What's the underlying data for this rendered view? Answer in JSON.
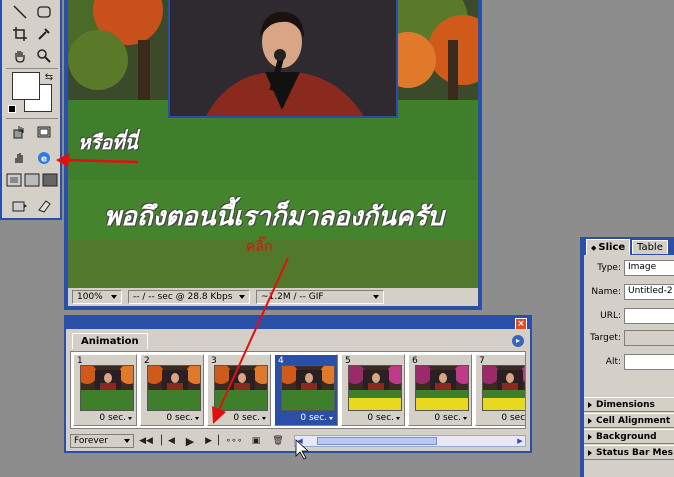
{
  "toolbox": {
    "tools": [
      "line-tool",
      "rounded-rect-tool",
      "crop-tool",
      "eyedropper-tool",
      "hand-tool",
      "zoom-tool",
      "rollover-tool",
      "slice-select-tool",
      "hand-select-tool",
      "jump-to-browser-tool",
      "standard-mode",
      "full-screen-menu-mode",
      "full-screen-mode",
      "jump-to-photoshop-tool",
      "eraser-tool"
    ]
  },
  "overlay": {
    "or_here": "หรือที่นี่",
    "main_caption": "พอถึงตอนนี้เราก็มาลองกันครับ",
    "click": "คลิ๊ก"
  },
  "statusbar": {
    "zoom": "100%",
    "timing": "-- / -- sec @ 28.8 Kbps",
    "size": "~1.2M / -- GIF"
  },
  "animation": {
    "title": "Animation",
    "frames": [
      {
        "num": "1",
        "delay": "0 sec.",
        "theme": "orange"
      },
      {
        "num": "2",
        "delay": "0 sec.",
        "theme": "orange"
      },
      {
        "num": "3",
        "delay": "0 sec.",
        "theme": "orange"
      },
      {
        "num": "4",
        "delay": "0 sec.",
        "theme": "orange",
        "selected": true
      },
      {
        "num": "5",
        "delay": "0 sec.",
        "theme": "yellow"
      },
      {
        "num": "6",
        "delay": "0 sec.",
        "theme": "yellow"
      },
      {
        "num": "7",
        "delay": "0 sec.",
        "theme": "yellow"
      }
    ],
    "loop": "Forever"
  },
  "slice_panel": {
    "tabs": [
      "Slice",
      "Table"
    ],
    "type_label": "Type:",
    "type_value": "Image",
    "name_label": "Name:",
    "name_value": "Untitled-2",
    "url_label": "URL:",
    "target_label": "Target:",
    "alt_label": "Alt:",
    "sections": [
      "Dimensions",
      "Cell Alignment",
      "Background",
      "Status Bar Mes"
    ]
  }
}
